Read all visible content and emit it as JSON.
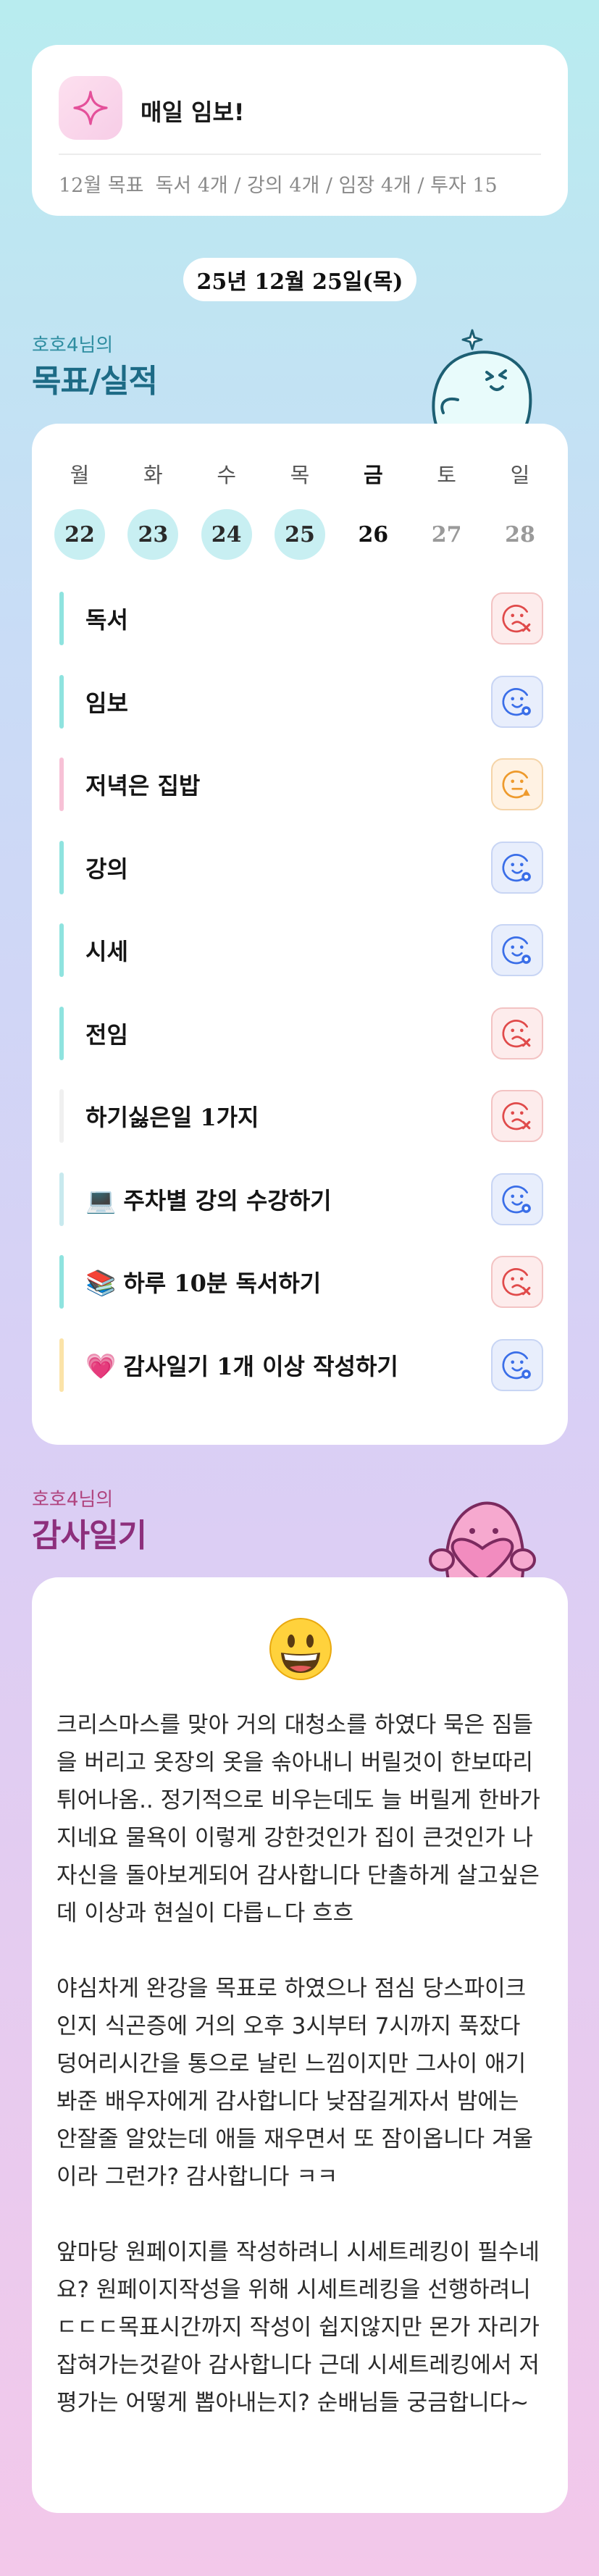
{
  "header": {
    "title": "매일 임보!",
    "goal_label": "12월 목표",
    "goal_detail": "독서 4개 / 강의 4개 / 임장 4개 / 투자 15"
  },
  "date": "25년 12월 25일(목)",
  "goals_section": {
    "subtitle": "호호4님의",
    "title": "목표/실적"
  },
  "week": [
    {
      "day": "월",
      "date": "22",
      "state": "done"
    },
    {
      "day": "화",
      "date": "23",
      "state": "done"
    },
    {
      "day": "수",
      "date": "24",
      "state": "done"
    },
    {
      "day": "목",
      "date": "25",
      "state": "done"
    },
    {
      "day": "금",
      "date": "26",
      "state": "today"
    },
    {
      "day": "토",
      "date": "27",
      "state": "future"
    },
    {
      "day": "일",
      "date": "28",
      "state": "future"
    }
  ],
  "goals": [
    {
      "emoji": "",
      "label": "독서",
      "status": "fail",
      "bar_color": "#8fe3df"
    },
    {
      "emoji": "",
      "label": "임보",
      "status": "done",
      "bar_color": "#8fe3df"
    },
    {
      "emoji": "",
      "label": "저녁은 집밥",
      "status": "partial",
      "bar_color": "#f7c1d6"
    },
    {
      "emoji": "",
      "label": "강의",
      "status": "done",
      "bar_color": "#8fe3df"
    },
    {
      "emoji": "",
      "label": "시세",
      "status": "done",
      "bar_color": "#8fe3df"
    },
    {
      "emoji": "",
      "label": "전임",
      "status": "fail",
      "bar_color": "#8fe3df"
    },
    {
      "emoji": "",
      "label": "하기싫은일 1가지",
      "status": "fail",
      "bar_color": "#f0f0f0"
    },
    {
      "emoji": "💻",
      "label": "주차별 강의 수강하기",
      "status": "done",
      "bar_color": "#c8e9ee"
    },
    {
      "emoji": "📚",
      "label": "하루 10분 독서하기",
      "status": "fail",
      "bar_color": "#8fe3df"
    },
    {
      "emoji": "💗",
      "label": "감사일기 1개 이상 작성하기",
      "status": "done",
      "bar_color": "#fbe3a8"
    }
  ],
  "diary_section": {
    "subtitle": "호호4님의",
    "title": "감사일기"
  },
  "diary": {
    "emoji": "😃",
    "paragraphs": [
      "크리스마스를 맞아 거의 대청소를 하였다 묵은 짐들을 버리고 옷장의 옷을 솎아내니 버릴것이 한보따리 튀어나옴.. 정기적으로 비우는데도 늘 버릴게 한바가지네요 물욕이 이렇게 강한것인가 집이 큰것인가 나자신을 돌아보게되어 감사합니다 단촐하게 살고싶은데 이상과 현실이 다릅ㄴ다 흐흐",
      "야심차게 완강을 목표로 하였으나 점심 당스파이크인지 식곤증에 거의 오후 3시부터 7시까지 푹잤다 덩어리시간을 통으로 날린 느낌이지만 그사이 애기 봐준 배우자에게 감사합니다 낮잠길게자서 밤에는 안잘줄 알았는데 애들 재우면서 또 잠이옵니다 겨울이라 그런가? 감사합니다 ㅋㅋ",
      "앞마당 원페이지를 작성하려니 시세트레킹이 필수네요? 원페이지작성을 위해 시세트레킹을 선행하려니 ㄷㄷㄷ목표시간까지 작성이 쉽지않지만 몬가 자리가 잡혀가는것같아 감사합니다 근데 시세트레킹에서 저평가는 어떻게 뽑아내는지? 순배님들 궁금합니다~"
    ]
  },
  "colors": {
    "done_circle": "#c8eff2",
    "fail": "#e04a4a",
    "done": "#3a6ee8",
    "partial": "#ee9a2c"
  }
}
